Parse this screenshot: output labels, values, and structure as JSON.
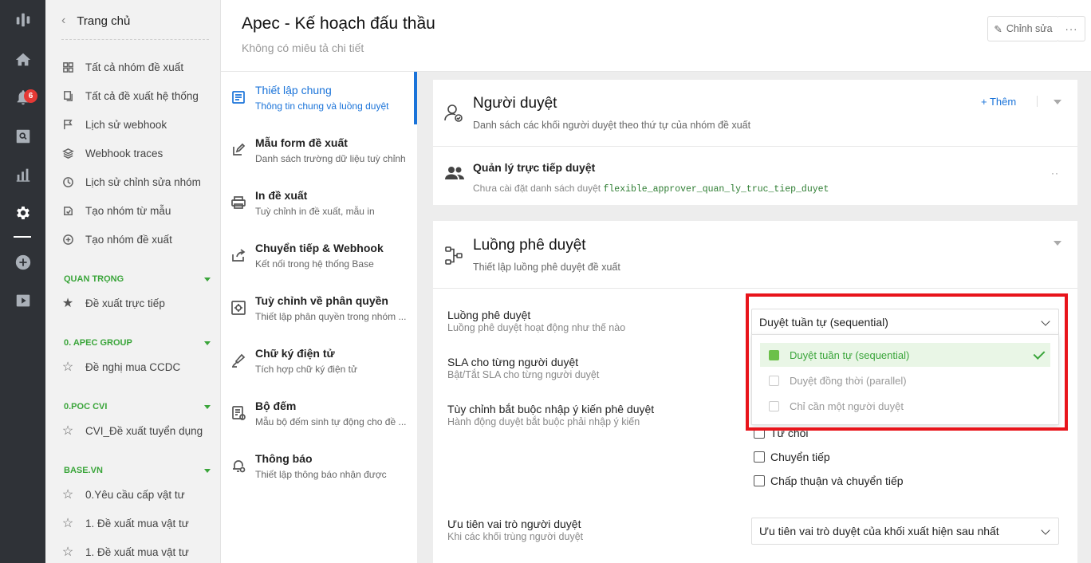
{
  "rail": {
    "notification_count": "6"
  },
  "sidebar": {
    "back_label": "Trang chủ",
    "items": [
      {
        "label": "Tất cả nhóm đề xuất"
      },
      {
        "label": "Tất cả đề xuất hệ thống"
      },
      {
        "label": "Lịch sử webhook"
      },
      {
        "label": "Webhook traces"
      },
      {
        "label": "Lịch sử chỉnh sửa nhóm"
      },
      {
        "label": "Tạo nhóm từ mẫu"
      },
      {
        "label": "Tạo nhóm đề xuất"
      }
    ],
    "sections": [
      {
        "title": "QUAN TRỌNG",
        "items": [
          "Đề xuất trực tiếp"
        ]
      },
      {
        "title": "0. APEC GROUP",
        "items": [
          "Đề nghị mua CCDC"
        ]
      },
      {
        "title": "0.POC CVI",
        "items": [
          "CVI_Đề xuất tuyển dụng"
        ]
      },
      {
        "title": "BASE.VN",
        "items": [
          "0.Yêu cầu cấp vật tư",
          "1. Đề xuất mua vật tư",
          "1. Đề xuất mua vật tư"
        ]
      }
    ]
  },
  "header": {
    "title": "Apec - Kế hoạch đấu thầu",
    "subtitle": "Không có miêu tả chi tiết",
    "edit_label": "Chỉnh sửa",
    "more_label": "···"
  },
  "settings_nav": [
    {
      "title": "Thiết lập chung",
      "desc": "Thông tin chung và luồng duyệt",
      "icon": "document-icon"
    },
    {
      "title": "Mẫu form đề xuất",
      "desc": "Danh sách trường dữ liệu tuỳ chỉnh",
      "icon": "edit-icon"
    },
    {
      "title": "In đề xuất",
      "desc": "Tuỳ chỉnh in đề xuất, mẫu in",
      "icon": "printer-icon"
    },
    {
      "title": "Chuyển tiếp & Webhook",
      "desc": "Kết nối trong hệ thống Base",
      "icon": "share-icon"
    },
    {
      "title": "Tuỳ chỉnh về phân quyền",
      "desc": "Thiết lập phân quyền trong nhóm ...",
      "icon": "permission-icon"
    },
    {
      "title": "Chữ ký điện tử",
      "desc": "Tích hợp chữ ký điện tử",
      "icon": "signature-icon"
    },
    {
      "title": "Bộ đếm",
      "desc": "Mẫu bộ đếm sinh tự động cho đề ...",
      "icon": "counter-icon"
    },
    {
      "title": "Thông báo",
      "desc": "Thiết lập thông báo nhận được",
      "icon": "bell-settings-icon"
    }
  ],
  "approvers": {
    "title": "Người duyệt",
    "subtitle": "Danh sách các khối người duyệt theo thứ tự của nhóm đề xuất",
    "add_label": "+ Thêm",
    "block": {
      "title": "Quản lý trực tiếp duyệt",
      "desc_prefix": "Chưa cài đặt danh sách duyệt ",
      "code": "flexible_approver_quan_ly_truc_tiep_duyet",
      "more_label": "··"
    }
  },
  "flow": {
    "title": "Luồng phê duyệt",
    "subtitle": "Thiết lập luồng phê duyệt đề xuất",
    "fields": [
      {
        "label": "Luồng phê duyệt",
        "sub": "Luồng phê duyệt hoạt động như thế nào"
      },
      {
        "label": "SLA cho từng người duyệt",
        "sub": "Bật/Tắt SLA cho từng người duyệt"
      },
      {
        "label": "Tùy chỉnh bắt buộc nhập ý kiến phê duyệt",
        "sub": "Hành động duyệt bắt buộc phải nhập ý kiến"
      },
      {
        "label": "Ưu tiên vai trò người duyệt",
        "sub": "Khi các khối trùng người duyệt"
      }
    ],
    "flow_select_value": "Duyệt tuần tự (sequential)",
    "flow_options": [
      {
        "label": "Duyệt tuần tự (sequential)",
        "selected": true
      },
      {
        "label": "Duyệt đồng thời (parallel)",
        "selected": false
      },
      {
        "label": "Chỉ cần một người duyệt",
        "selected": false
      }
    ],
    "comment_checkboxes": [
      "Từ chối",
      "Chuyển tiếp",
      "Chấp thuận và chuyển tiếp"
    ],
    "priority_select_value": "Ưu tiên vai trò duyệt của khối xuất hiện sau nhất"
  },
  "colors": {
    "accent_blue": "#1a73d9",
    "green": "#3aa53a",
    "highlight_red": "#e8141b",
    "rail_bg": "#2f3237"
  }
}
